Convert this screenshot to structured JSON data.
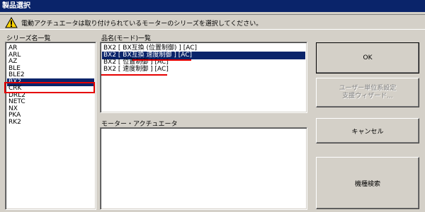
{
  "window": {
    "title": "製品選択"
  },
  "info": {
    "icon": "warning-icon",
    "message": "電動アクチュエータは取り付けられているモーターのシリーズを選択してください。"
  },
  "series_list": {
    "label": "シリーズ名一覧",
    "items": [
      "AR",
      "ARL",
      "AZ",
      "BLE",
      "BLE2",
      "BX2",
      "CRK",
      "DRL2",
      "NETC",
      "NX",
      "PKA",
      "RK2"
    ],
    "selected_index": 5
  },
  "product_list": {
    "label": "品名(モード)一覧",
    "items": [
      "BX2 [ BX互換 (位置制御) ] [AC]",
      "BX2 [ BX互換 速度制御 ] [AC]",
      "BX2 [ 位置制御 ] [AC]",
      "BX2 [ 速度制御 ] [AC]"
    ],
    "selected_index": 1
  },
  "motor_panel": {
    "label": "モーター・アクチュエータ"
  },
  "buttons": {
    "ok": "OK",
    "wizard_line1": "ユーザー単位系設定",
    "wizard_line2": "支援ウィザード...",
    "cancel": "キャンセル",
    "search": "機種検索"
  },
  "colors": {
    "selection": "#0a246a",
    "annotation_red": "#e60000",
    "dialog_bg": "#d4d0c8"
  }
}
